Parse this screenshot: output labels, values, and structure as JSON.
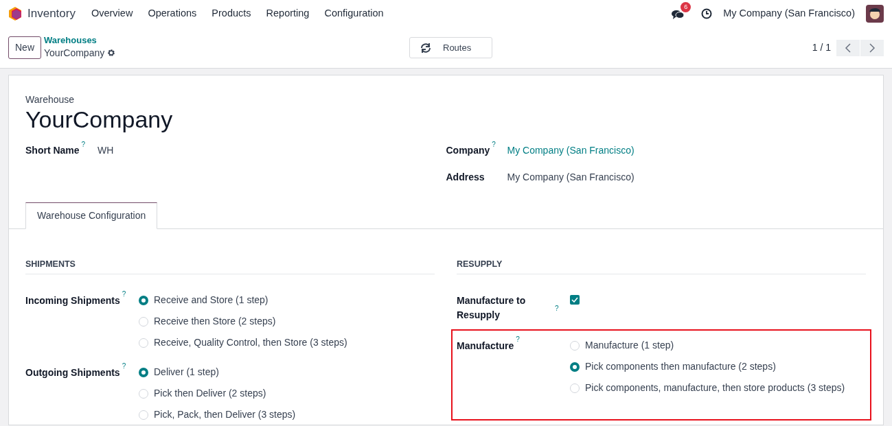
{
  "app": {
    "name": "Inventory",
    "menu": [
      "Overview",
      "Operations",
      "Products",
      "Reporting",
      "Configuration"
    ]
  },
  "systray": {
    "messages_count": "6",
    "company": "My Company (San Francisco)"
  },
  "control_panel": {
    "new_button": "New",
    "breadcrumb": "Warehouses",
    "record": "YourCompany",
    "routes_button": "Routes",
    "pager": "1 / 1"
  },
  "form": {
    "label": "Warehouse",
    "title": "YourCompany",
    "fields_left": [
      {
        "label": "Short Name",
        "help": "?",
        "value": "WH"
      }
    ],
    "fields_right": [
      {
        "label": "Company",
        "help": "?",
        "value": "My Company (San Francisco)",
        "kind": "link"
      },
      {
        "label": "Address",
        "value": "My Company (San Francisco)",
        "kind": "text"
      }
    ]
  },
  "tabs": [
    {
      "label": "Warehouse Configuration",
      "selected": true
    }
  ],
  "sections": [
    {
      "title": "SHIPMENTS",
      "fields": [
        {
          "label": "Incoming Shipments",
          "help": "?",
          "kind": "radio",
          "highlighted": false,
          "options": [
            {
              "label": "Receive and Store (1 step)",
              "selected": true
            },
            {
              "label": "Receive then Store (2 steps)",
              "selected": false
            },
            {
              "label": "Receive, Quality Control, then Store (3 steps)",
              "selected": false
            }
          ]
        },
        {
          "label": "Outgoing Shipments",
          "help": "?",
          "kind": "radio",
          "highlighted": false,
          "options": [
            {
              "label": "Deliver (1 step)",
              "selected": true
            },
            {
              "label": "Pick then Deliver (2 steps)",
              "selected": false
            },
            {
              "label": "Pick, Pack, then Deliver (3 steps)",
              "selected": false
            }
          ]
        }
      ]
    },
    {
      "title": "RESUPPLY",
      "fields": [
        {
          "label": "Manufacture to Resupply",
          "help": "?",
          "kind": "checkbox",
          "checked": true,
          "highlighted": false
        },
        {
          "label": "Manufacture",
          "help": "?",
          "kind": "radio",
          "highlighted": true,
          "options": [
            {
              "label": "Manufacture (1 step)",
              "selected": false
            },
            {
              "label": "Pick components then manufacture (2 steps)",
              "selected": true
            },
            {
              "label": "Pick components, manufacture, then store products (3 steps)",
              "selected": false
            }
          ]
        }
      ]
    }
  ]
}
